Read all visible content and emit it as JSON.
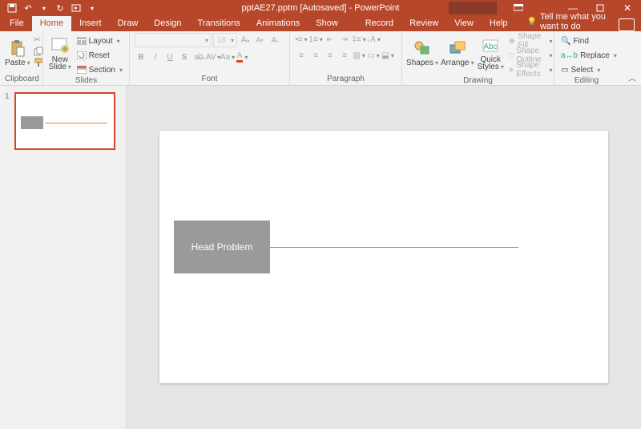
{
  "title": "pptAE27.pptm [Autosaved] - PowerPoint",
  "tabs": {
    "file": "File",
    "home": "Home",
    "insert": "Insert",
    "draw": "Draw",
    "design": "Design",
    "transitions": "Transitions",
    "animations": "Animations",
    "slideshow": "Slide Show",
    "record": "Record",
    "review": "Review",
    "view": "View",
    "help": "Help",
    "tellme": "Tell me what you want to do"
  },
  "ribbon": {
    "clipboard": {
      "label": "Clipboard",
      "paste": "Paste"
    },
    "slides": {
      "label": "Slides",
      "newslide": "New\nSlide",
      "layout": "Layout",
      "reset": "Reset",
      "section": "Section"
    },
    "font": {
      "label": "Font",
      "name": "",
      "size": "18"
    },
    "paragraph": {
      "label": "Paragraph"
    },
    "drawing": {
      "label": "Drawing",
      "shapes": "Shapes",
      "arrange": "Arrange",
      "quick": "Quick\nStyles",
      "fill": "Shape Fill",
      "outline": "Shape Outline",
      "effects": "Shape Effects"
    },
    "editing": {
      "label": "Editing",
      "find": "Find",
      "replace": "Replace",
      "select": "Select"
    }
  },
  "thumb": {
    "num": "1"
  },
  "slide": {
    "boxtext": "Head Problem"
  }
}
